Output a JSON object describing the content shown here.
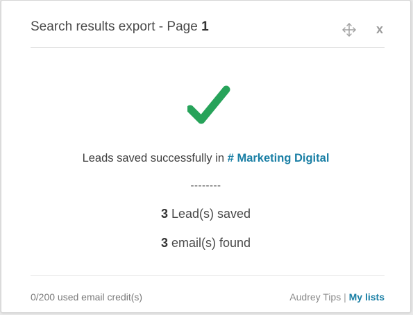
{
  "dialog": {
    "title_prefix": "Search results export - Page",
    "page_number": "1",
    "move_icon": "move-arrows-icon",
    "close_label": "x"
  },
  "result": {
    "icon": "checkmark-icon",
    "icon_color": "#27a35a",
    "message_prefix": "Leads saved successfully in",
    "list_name": "# Marketing Digital",
    "separator": "--------",
    "leads_count": "3",
    "leads_label": "Lead(s) saved",
    "emails_count": "3",
    "emails_label": "email(s) found"
  },
  "footer": {
    "credits": "0/200 used email credit(s)",
    "tips_label": "Audrey Tips",
    "divider": "|",
    "my_lists_label": "My lists"
  },
  "colors": {
    "link": "#1a7fa5",
    "success": "#27a35a"
  }
}
